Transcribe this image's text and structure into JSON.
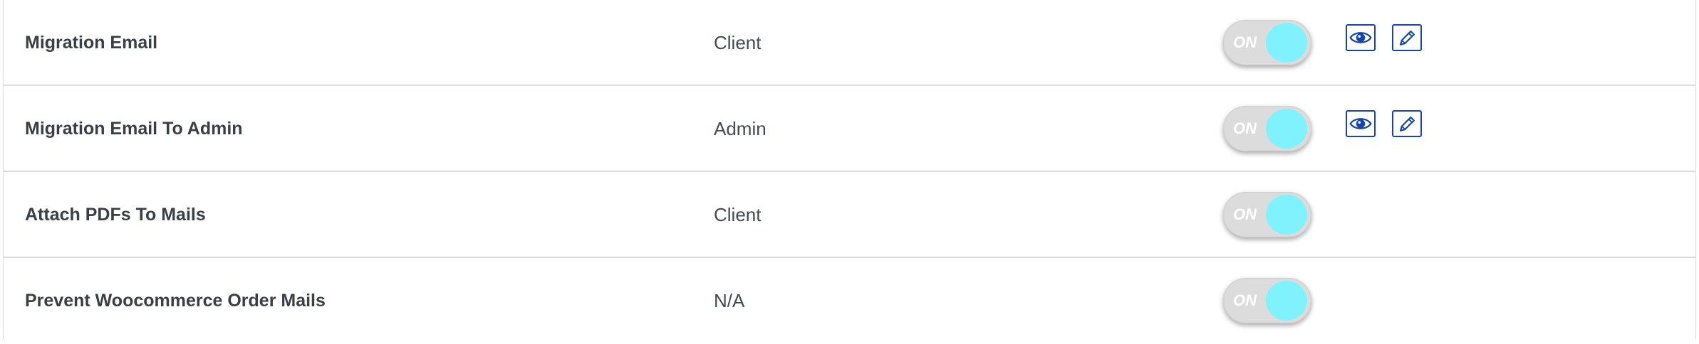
{
  "toggle_label": "ON",
  "colors": {
    "toggle_track": "#dddcdc",
    "toggle_knob": "#7ff2fd",
    "icon_blue": "#1546a8",
    "row_border": "#dcdcdc",
    "text_dark": "#3a3f45"
  },
  "rows": [
    {
      "name": "Migration Email",
      "recipient": "Client",
      "status": "ON",
      "actions": [
        "eye-icon",
        "pencil-icon"
      ]
    },
    {
      "name": "Migration Email To Admin",
      "recipient": "Admin",
      "status": "ON",
      "actions": [
        "eye-icon",
        "pencil-icon"
      ]
    },
    {
      "name": "Attach PDFs To Mails",
      "recipient": "Client",
      "status": "ON",
      "actions": []
    },
    {
      "name": "Prevent Woocommerce Order Mails",
      "recipient": "N/A",
      "status": "ON",
      "actions": []
    }
  ]
}
